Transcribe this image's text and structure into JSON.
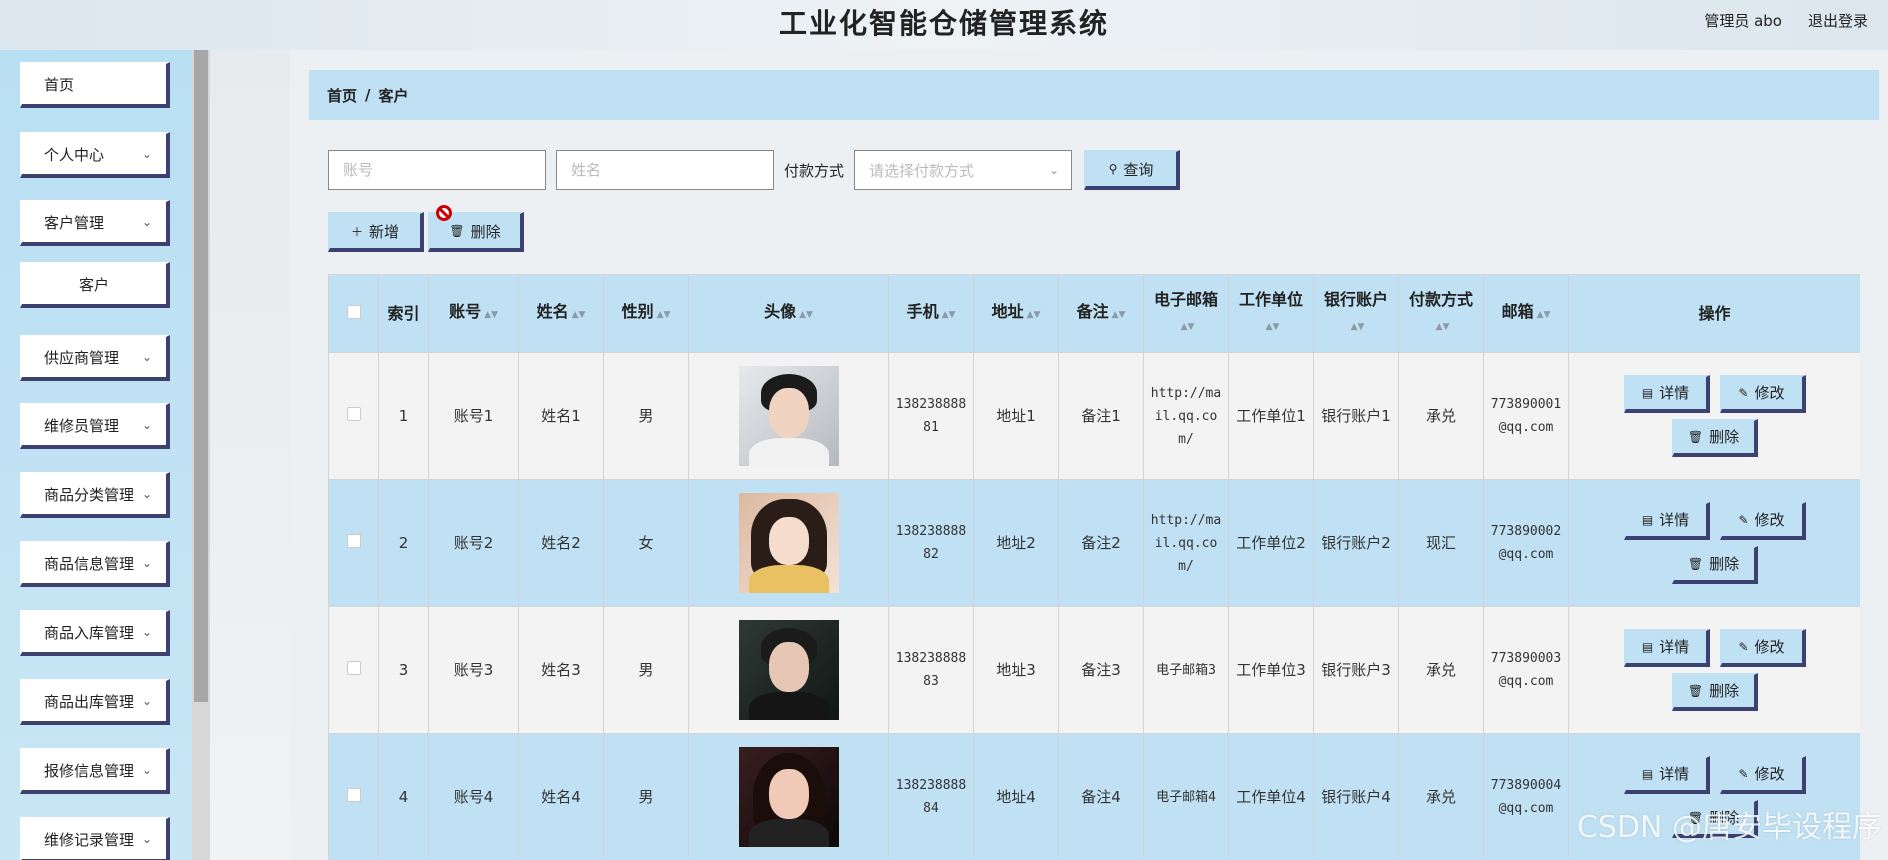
{
  "header": {
    "title": "工业化智能仓储管理系统",
    "user_label": "管理员 abo",
    "logout_label": "退出登录"
  },
  "sidebar": {
    "items": [
      {
        "label": "首页",
        "has_chevron": false
      },
      {
        "label": "个人中心",
        "has_chevron": true
      },
      {
        "label": "客户管理",
        "has_chevron": true
      },
      {
        "label": "客户",
        "has_chevron": false,
        "submenu": true
      },
      {
        "label": "供应商管理",
        "has_chevron": true
      },
      {
        "label": "维修员管理",
        "has_chevron": true
      },
      {
        "label": "商品分类管理",
        "has_chevron": true
      },
      {
        "label": "商品信息管理",
        "has_chevron": true
      },
      {
        "label": "商品入库管理",
        "has_chevron": true
      },
      {
        "label": "商品出库管理",
        "has_chevron": true
      },
      {
        "label": "报修信息管理",
        "has_chevron": true
      },
      {
        "label": "维修记录管理",
        "has_chevron": true
      }
    ]
  },
  "breadcrumb": {
    "home": "首页",
    "separator": "/",
    "current": "客户"
  },
  "search": {
    "account_placeholder": "账号",
    "name_placeholder": "姓名",
    "payment_label": "付款方式",
    "payment_placeholder": "请选择付款方式",
    "query_label": "查询"
  },
  "actions": {
    "add_label": "新增",
    "delete_label": "删除"
  },
  "table": {
    "columns": [
      "索引",
      "账号",
      "姓名",
      "性别",
      "头像",
      "手机",
      "地址",
      "备注",
      "电子邮箱",
      "工作单位",
      "银行账户",
      "付款方式",
      "邮箱",
      "操作"
    ],
    "rows": [
      {
        "index": "1",
        "account": "账号1",
        "name": "姓名1",
        "gender": "男",
        "phone": "13823888881",
        "address": "地址1",
        "remark": "备注1",
        "email": "http://mail.qq.com/",
        "company": "工作单位1",
        "bank": "银行账户1",
        "payment": "承兑",
        "mailbox": "773890001@qq.com"
      },
      {
        "index": "2",
        "account": "账号2",
        "name": "姓名2",
        "gender": "女",
        "phone": "13823888882",
        "address": "地址2",
        "remark": "备注2",
        "email": "http://mail.qq.com/",
        "company": "工作单位2",
        "bank": "银行账户2",
        "payment": "现汇",
        "mailbox": "773890002@qq.com"
      },
      {
        "index": "3",
        "account": "账号3",
        "name": "姓名3",
        "gender": "男",
        "phone": "13823888883",
        "address": "地址3",
        "remark": "备注3",
        "email": "电子邮箱3",
        "company": "工作单位3",
        "bank": "银行账户3",
        "payment": "承兑",
        "mailbox": "773890003@qq.com"
      },
      {
        "index": "4",
        "account": "账号4",
        "name": "姓名4",
        "gender": "男",
        "phone": "13823888884",
        "address": "地址4",
        "remark": "备注4",
        "email": "电子邮箱4",
        "company": "工作单位4",
        "bank": "银行账户4",
        "payment": "承兑",
        "mailbox": "773890004@qq.com"
      }
    ],
    "row_actions": {
      "detail_label": "详情",
      "edit_label": "修改",
      "delete_label": "删除"
    }
  },
  "watermark": "CSDN @唐安毕设程序",
  "colors": {
    "accent": "#bfe1f3",
    "border_dark": "#3d4170",
    "row_alt": "#f3f3f3"
  }
}
